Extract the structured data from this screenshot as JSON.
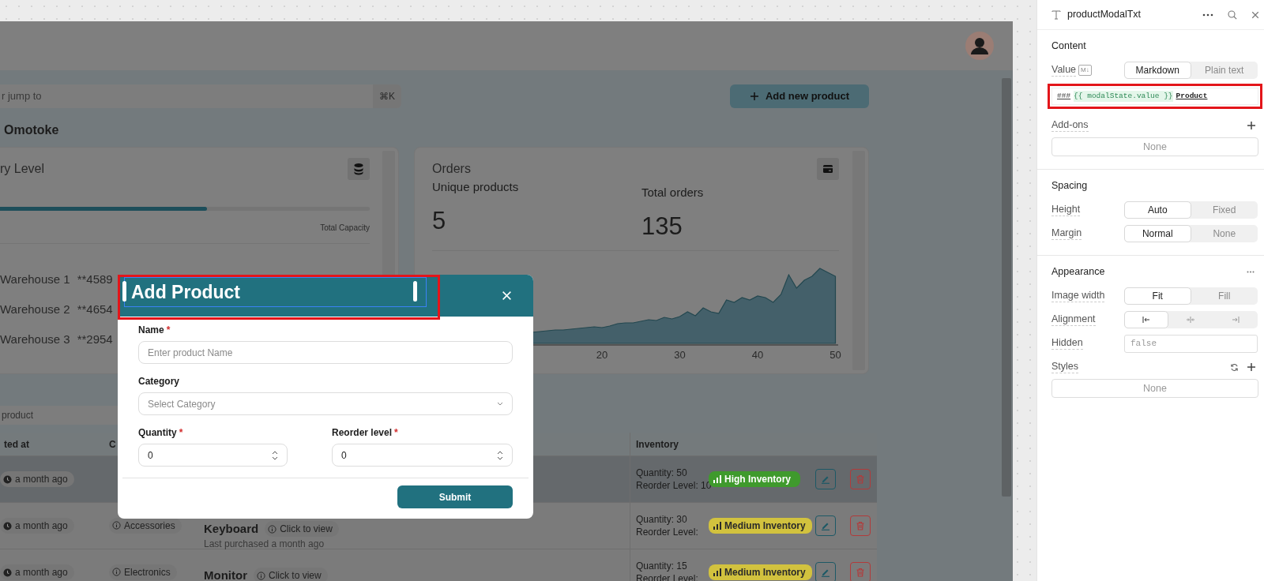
{
  "app": {
    "search": {
      "placeholder": "r jump to",
      "shortcut": "⌘K"
    },
    "add_button": {
      "label": "Add new product"
    },
    "greeting": "Omotoke",
    "inventory_card": {
      "title": "ry Level",
      "level": 0.56,
      "capacity_label": "Total Capacity",
      "warehouses": [
        {
          "name": "Warehouse 1",
          "code": "**4589"
        },
        {
          "name": "Warehouse 2",
          "code": "**4654"
        },
        {
          "name": "Warehouse 3",
          "code": "**2954"
        }
      ]
    },
    "orders_card": {
      "title": "Orders",
      "stats": [
        {
          "label": "Unique products",
          "value": "5"
        },
        {
          "label": "Total orders",
          "value": "135"
        }
      ],
      "axis_labels": [
        "20",
        "30",
        "40",
        "50"
      ]
    },
    "table_search": {
      "placeholder": "product"
    },
    "table": {
      "columns": [
        "ted at",
        "C",
        "Inventory"
      ],
      "rows": [
        {
          "created": "a month ago",
          "hovered": true,
          "quantity": "Quantity: 50",
          "reorder": "Reorder Level: 10",
          "badge": {
            "label": "High Inventory",
            "color": "#3f9a2d"
          }
        },
        {
          "created": "a month ago",
          "hovered": false,
          "category": "Accessories",
          "product": "Keyboard",
          "link": "Click to view",
          "last_purchased": "Last purchased a month ago",
          "quantity": "Quantity: 30",
          "reorder": "Reorder Level:",
          "badge": {
            "label": "Medium Inventory",
            "color": "#d2c23e"
          }
        },
        {
          "created": "a month ago",
          "hovered": false,
          "category": "Electronics",
          "product": "Monitor",
          "link": "Click to view",
          "quantity": "Quantity: 15",
          "reorder": "Reorder Level:",
          "badge": {
            "label": "Medium Inventory",
            "color": "#d2c23e"
          }
        }
      ]
    }
  },
  "modal": {
    "title": "Add Product",
    "title_highlighted": true,
    "fields": [
      {
        "kind": "text",
        "label": "Name",
        "required_mark": "*",
        "placeholder": "Enter product Name"
      },
      {
        "kind": "select",
        "label": "Category",
        "placeholder": "Select Category"
      },
      {
        "kind": "number",
        "label": "Quantity",
        "required_mark": "*",
        "value": "0"
      },
      {
        "kind": "number",
        "label": "Reorder level",
        "required_mark": "*",
        "value": "0"
      }
    ],
    "submit": "Submit"
  },
  "inspector": {
    "title": "productModalTxt",
    "sections": [
      {
        "title": "Content",
        "menu": false,
        "rows": [
          {
            "kind": "segmented",
            "label": "Value",
            "tag": "M↓",
            "options": [
              {
                "label": "Markdown",
                "selected": true
              },
              {
                "label": "Plain text",
                "selected": false
              }
            ]
          },
          {
            "kind": "code",
            "highlighted": true,
            "tokens": [
              {
                "kind": "heading",
                "text": "###"
              },
              {
                "kind": "template",
                "text": "{{ modalState.value }}"
              },
              {
                "kind": "text",
                "text": "Product"
              }
            ]
          },
          {
            "kind": "list",
            "label": "Add-ons",
            "add_action": true,
            "refresh_action": false,
            "value": "None"
          }
        ]
      },
      {
        "title": "Spacing",
        "menu": false,
        "rows": [
          {
            "kind": "segmented",
            "label": "Height",
            "options": [
              {
                "label": "Auto",
                "selected": true
              },
              {
                "label": "Fixed",
                "selected": false
              }
            ]
          },
          {
            "kind": "segmented",
            "label": "Margin",
            "options": [
              {
                "label": "Normal",
                "selected": true
              },
              {
                "label": "None",
                "selected": false
              }
            ]
          }
        ]
      },
      {
        "title": "Appearance",
        "menu": true,
        "rows": [
          {
            "kind": "segmented",
            "label": "Image width",
            "options": [
              {
                "label": "Fit",
                "selected": true
              },
              {
                "label": "Fill",
                "selected": false
              }
            ]
          },
          {
            "kind": "icons",
            "label": "Alignment",
            "options": [
              {
                "selected": true
              },
              {
                "selected": false
              },
              {
                "selected": false
              }
            ]
          },
          {
            "kind": "field",
            "label": "Hidden",
            "placeholder": "false"
          },
          {
            "kind": "list",
            "label": "Styles",
            "add_action": true,
            "refresh_action": true,
            "value": "None"
          }
        ]
      }
    ]
  }
}
